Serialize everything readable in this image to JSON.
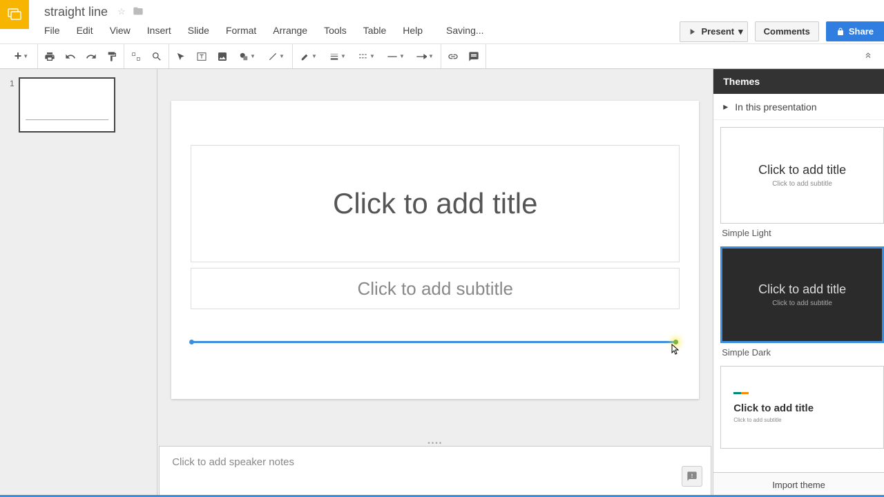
{
  "header": {
    "doc_title": "straight line",
    "saving": "Saving...",
    "present": "Present",
    "comments": "Comments",
    "share": "Share"
  },
  "menu": {
    "file": "File",
    "edit": "Edit",
    "view": "View",
    "insert": "Insert",
    "slide": "Slide",
    "format": "Format",
    "arrange": "Arrange",
    "tools": "Tools",
    "table": "Table",
    "help": "Help"
  },
  "filmstrip": {
    "slide1_num": "1"
  },
  "canvas": {
    "title_placeholder": "Click to add title",
    "subtitle_placeholder": "Click to add subtitle"
  },
  "notes": {
    "placeholder": "Click to add speaker notes"
  },
  "themes": {
    "header": "Themes",
    "sub": "In this presentation",
    "light_name": "Simple Light",
    "dark_name": "Simple Dark",
    "preview_title": "Click to add title",
    "preview_sub": "Click to add subtitle",
    "import": "Import theme"
  }
}
